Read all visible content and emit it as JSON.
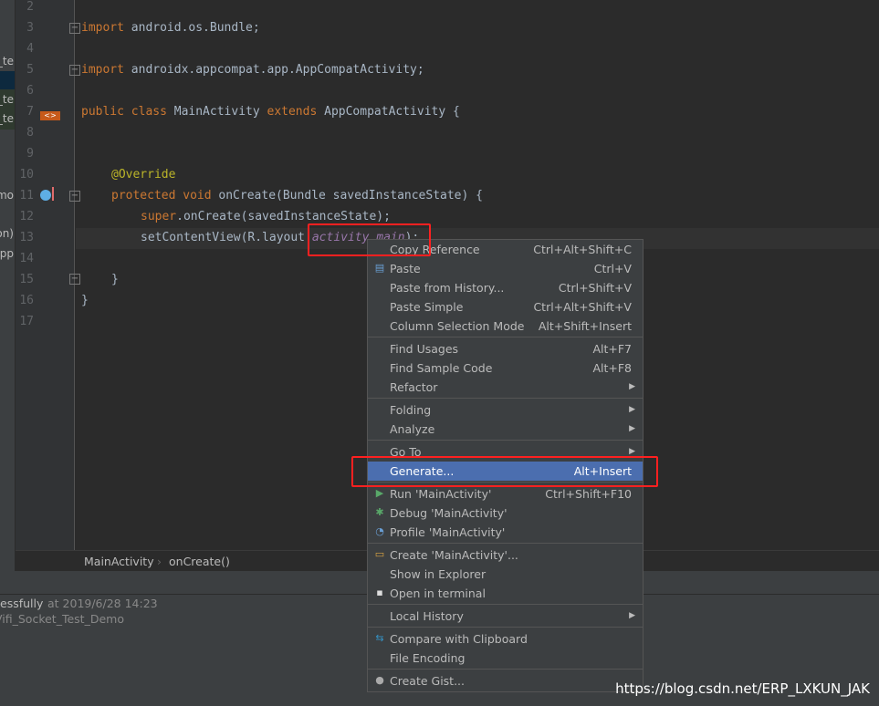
{
  "project_panel": {
    "items": [
      "_te",
      "_te",
      "_te",
      "emo",
      "on)",
      "app"
    ]
  },
  "gutter": {
    "line_numbers": [
      "2",
      "3",
      "4",
      "5",
      "6",
      "7",
      "8",
      "9",
      "10",
      "11",
      "12",
      "13",
      "14",
      "15",
      "16",
      "17"
    ]
  },
  "code": {
    "l3": [
      "import",
      " android.os.Bundle;"
    ],
    "l5": [
      "import",
      " androidx.appcompat.app.AppCompatActivity;"
    ],
    "l7": [
      "public class ",
      "MainActivity ",
      "extends ",
      "AppCompatActivity {"
    ],
    "l10": "@Override",
    "l11": [
      "protected void ",
      "onCreate(Bundle savedInstanceState) {"
    ],
    "l12": [
      "super",
      ".onCreate(savedInstanceState);"
    ],
    "l13": [
      "setContentView(R.layout.",
      "activity_main",
      ");"
    ],
    "l15": "}",
    "l16": "}"
  },
  "breadcrumb": {
    "class": "MainActivity",
    "sep": "›",
    "method": "onCreate()"
  },
  "bottom": {
    "status": "essfully",
    "time": "at 2019/6/28 14:23",
    "project": "Vifi_Socket_Test_Demo"
  },
  "menu": {
    "items": [
      {
        "label": "Copy Reference",
        "shortcut": "Ctrl+Alt+Shift+C"
      },
      {
        "label": "Paste",
        "shortcut": "Ctrl+V",
        "icon": "clipboard-icon"
      },
      {
        "label": "Paste from History...",
        "shortcut": "Ctrl+Shift+V"
      },
      {
        "label": "Paste Simple",
        "shortcut": "Ctrl+Alt+Shift+V"
      },
      {
        "label": "Column Selection Mode",
        "shortcut": "Alt+Shift+Insert"
      },
      {
        "label": "Find Usages",
        "shortcut": "Alt+F7"
      },
      {
        "label": "Find Sample Code",
        "shortcut": "Alt+F8"
      },
      {
        "label": "Refactor",
        "submenu": true
      },
      {
        "label": "Folding",
        "submenu": true
      },
      {
        "label": "Analyze",
        "submenu": true
      },
      {
        "label": "Go To",
        "submenu": true
      },
      {
        "label": "Generate...",
        "shortcut": "Alt+Insert",
        "selected": true
      },
      {
        "label": "Run 'MainActivity'",
        "shortcut": "Ctrl+Shift+F10",
        "icon": "run-icon"
      },
      {
        "label": "Debug 'MainActivity'",
        "icon": "debug-icon"
      },
      {
        "label": "Profile 'MainActivity'",
        "icon": "profile-icon"
      },
      {
        "label": "Create 'MainActivity'...",
        "icon": "create-config-icon"
      },
      {
        "label": "Show in Explorer"
      },
      {
        "label": "Open in terminal",
        "icon": "terminal-icon"
      },
      {
        "label": "Local History",
        "submenu": true
      },
      {
        "label": "Compare with Clipboard",
        "icon": "compare-icon"
      },
      {
        "label": "File Encoding"
      },
      {
        "label": "Create Gist...",
        "icon": "github-icon"
      }
    ]
  },
  "colors": {
    "keyword": "#cc7832",
    "annotation": "#bbb529",
    "field": "#9876aa",
    "selection": "#4b6eaf",
    "highlight_box": "#ff2020"
  },
  "watermark": "https://blog.csdn.net/ERP_LXKUN_JAK"
}
